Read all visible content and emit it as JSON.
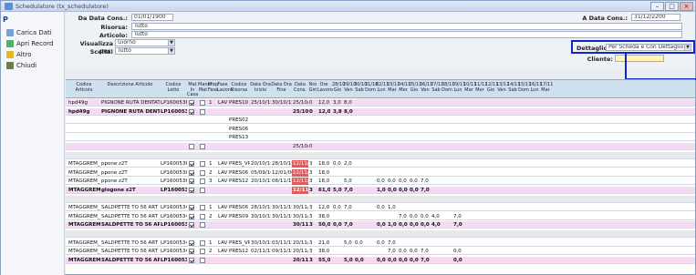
{
  "window": {
    "title": "Schedulatore (tx_schedulatore)",
    "controls": [
      "–",
      "□",
      "×"
    ]
  },
  "sidebar": {
    "items": [
      {
        "label": "Carica Dati",
        "icon": "refresh-icon"
      },
      {
        "label": "Apri Record",
        "icon": "open-record-icon"
      },
      {
        "label": "Altro",
        "icon": "more-icon"
      },
      {
        "label": "Chiudi",
        "icon": "close-icon"
      }
    ]
  },
  "filters": {
    "da_data_cons_label": "Da Data Cons.:",
    "da_data_cons_value": "01/01/1900",
    "a_data_cons_label": "A Data Cons.:",
    "a_data_cons_value": "31/12/2200",
    "risorsa_label": "Risorsa:",
    "risorsa_value": "Tutto",
    "articolo_label": "Articolo:",
    "articolo_value": "Tutto",
    "visualizza_label": "Visualizza per:",
    "visualizza_value": "Giorno",
    "scelta_label": "Scelta:",
    "scelta_value": "Tutto",
    "dettaglio_label": "Dettaglio:",
    "dettaglio_value": "Per Scheda e Con Dettaglio",
    "cliente_label": "Cliente:",
    "cliente_value": ""
  },
  "grid": {
    "columns": [
      "Codice Articolo",
      "Descrizione Articolo",
      "Codice Lotto",
      "Mat In Casa",
      "Manuf Mat",
      "Prep Fase",
      "Fase Lavoro",
      "Codice Risorsa",
      "Data Ora Inizio",
      "Data Ora Fine",
      "Data Cons.",
      "Nro Giri",
      "Ore Lavoro"
    ],
    "days": [
      "28/10 Gio",
      "29/10 Ven",
      "30/10 Sab",
      "31/10 Dom",
      "02/11 Lun",
      "03/11 Mar",
      "04/11 Mer",
      "05/11 Gio",
      "06/11 Ven",
      "07/11 Sab",
      "08/11 Dom",
      "09/11 Lun",
      "10/11 Mar",
      "11/11 Mer",
      "12/11 Gio",
      "13/11 Ven",
      "14/11 Sab",
      "15/11 Dom",
      "16/11 Lun",
      "17/11 Mar"
    ],
    "rows": [
      {
        "style": "pink",
        "art": "hpd49g",
        "desc": "PIGNONE RUTA DENTATA",
        "lotto": "LP1600536",
        "cb1": true,
        "cb2": false,
        "prep": "1",
        "fase": "LAV",
        "ris": "PRES10",
        "inizio": "25/10/15",
        "fine": "30/10/15",
        "cons": "25/10/15",
        "giri": "0",
        "ore": "12,0",
        "d1": "3,0",
        "d2": "8,0",
        "d3": "",
        "d4": "",
        "d5": "",
        "d6": "",
        "d7": "",
        "d8": "",
        "d9": "",
        "d10": "",
        "d11": "",
        "d12": ""
      },
      {
        "style": "pink",
        "art": "hpd49g",
        "desc": "PIGNONE RUTA DENTATA",
        "lotto": "LP1600536",
        "cb1": true,
        "cb2": false,
        "prep": "",
        "fase": "",
        "ris": "",
        "inizio": "",
        "fine": "",
        "cons": "25/10/15",
        "giri": "0",
        "ore": "12,0",
        "d1": "3,8",
        "d2": "8,0",
        "d3": "",
        "d4": "",
        "d5": "",
        "d6": "",
        "d7": "",
        "d8": "",
        "d9": "",
        "d10": "",
        "d11": "",
        "d12": "",
        "bold": true
      },
      {
        "style": "white",
        "art": "",
        "desc": "",
        "lotto": "",
        "cb1": null,
        "cb2": null,
        "prep": "",
        "fase": "",
        "ris": "PRES02",
        "inizio": "",
        "fine": "",
        "cons": "",
        "giri": "",
        "ore": "",
        "d1": "",
        "d2": "",
        "d3": "",
        "d4": "",
        "d5": "",
        "d6": "",
        "d7": "",
        "d8": "",
        "d9": "",
        "d10": "",
        "d11": "",
        "d12": ""
      },
      {
        "style": "white",
        "art": "",
        "desc": "",
        "lotto": "",
        "cb1": null,
        "cb2": null,
        "prep": "",
        "fase": "",
        "ris": "PRES06",
        "inizio": "",
        "fine": "",
        "cons": "",
        "giri": "",
        "ore": "",
        "d1": "",
        "d2": "",
        "d3": "",
        "d4": "",
        "d5": "",
        "d6": "",
        "d7": "",
        "d8": "",
        "d9": "",
        "d10": "",
        "d11": "",
        "d12": ""
      },
      {
        "style": "white",
        "art": "",
        "desc": "",
        "lotto": "",
        "cb1": null,
        "cb2": null,
        "prep": "",
        "fase": "",
        "ris": "PRES13",
        "inizio": "",
        "fine": "",
        "cons": "",
        "giri": "",
        "ore": "",
        "d1": "",
        "d2": "",
        "d3": "",
        "d4": "",
        "d5": "",
        "d6": "",
        "d7": "",
        "d8": "",
        "d9": "",
        "d10": "",
        "d11": "",
        "d12": ""
      },
      {
        "style": "pink",
        "art": "",
        "desc": "",
        "lotto": "",
        "cb1": false,
        "cb2": false,
        "prep": "",
        "fase": "",
        "ris": "",
        "inizio": "",
        "fine": "",
        "cons": "25/10/15",
        "giri": "0",
        "ore": "",
        "d1": "",
        "d2": "",
        "d3": "",
        "d4": "",
        "d5": "",
        "d6": "",
        "d7": "",
        "d8": "",
        "d9": "",
        "d10": "",
        "d11": "",
        "d12": ""
      },
      {
        "style": "sep",
        "art": "",
        "desc": "",
        "lotto": "",
        "cb1": null,
        "cb2": null,
        "prep": "",
        "fase": "",
        "ris": "",
        "inizio": "",
        "fine": "",
        "cons": "",
        "giri": "",
        "ore": "",
        "d1": "",
        "d2": "",
        "d3": "",
        "d4": "",
        "d5": "",
        "d6": "",
        "d7": "",
        "d8": "",
        "d9": "",
        "d10": "",
        "d11": "",
        "d12": ""
      },
      {
        "style": "white",
        "art": "MTAGGREM_SALD",
        "desc": "ppone z2T",
        "lotto": "LP1600536",
        "cb1": true,
        "cb2": false,
        "prep": "1",
        "fase": "LAV",
        "ris": "PRES_VP",
        "inizio": "20/10/15",
        "fine": "28/10/15",
        "cons": "12/11/15",
        "giri": "3",
        "ore": "18,0",
        "d1": "0,0",
        "d2": "2,0",
        "d3": "",
        "d4": "",
        "d5": "",
        "d6": "",
        "d7": "",
        "d8": "",
        "d9": "",
        "d10": "",
        "d11": "",
        "d12": "",
        "redcons": true
      },
      {
        "style": "white",
        "art": "MTAGGREM_SALD",
        "desc": "ppone z2T",
        "lotto": "LP1600536",
        "cb1": true,
        "cb2": false,
        "prep": "2",
        "fase": "LAV",
        "ris": "PRES06",
        "inizio": "05/09/16",
        "fine": "12/01/00",
        "cons": "12/11/15",
        "giri": "3",
        "ore": "18,0",
        "d1": "",
        "d2": "",
        "d3": "",
        "d4": "",
        "d5": "",
        "d6": "",
        "d7": "",
        "d8": "",
        "d9": "",
        "d10": "",
        "d11": "",
        "d12": "",
        "redcons": true
      },
      {
        "style": "white",
        "art": "MTAGGREM_SALD",
        "desc": "ppone z2T",
        "lotto": "LP1600536",
        "cb1": true,
        "cb2": false,
        "prep": "3",
        "fase": "LAV",
        "ris": "PRES12",
        "inizio": "20/10/15",
        "fine": "08/11/15",
        "cons": "12/11/15",
        "giri": "3",
        "ore": "18,0",
        "d1": "",
        "d2": "5,0",
        "d3": "",
        "d4": "",
        "d5": "0,0",
        "d6": "0,0",
        "d7": "0,0",
        "d8": "0,0",
        "d9": "7,0",
        "d10": "",
        "d11": "",
        "d12": "",
        "redcons": true
      },
      {
        "style": "pink",
        "art": "MTAGGREM_SALD",
        "desc": "glogone z2T",
        "lotto": "LP1600536",
        "cb1": true,
        "cb2": false,
        "prep": "",
        "fase": "",
        "ris": "",
        "inizio": "",
        "fine": "",
        "cons": "12/11/15",
        "giri": "3",
        "ore": "61,0",
        "d1": "5,0",
        "d2": "7,0",
        "d3": "",
        "d4": "",
        "d5": "1,0",
        "d6": "0,0",
        "d7": "0,0",
        "d8": "0,0",
        "d9": "7,0",
        "d10": "",
        "d11": "",
        "d12": "",
        "bold": true,
        "redcons": true
      },
      {
        "style": "sep",
        "art": "",
        "desc": "",
        "lotto": "",
        "cb1": null,
        "cb2": null,
        "prep": "",
        "fase": "",
        "ris": "",
        "inizio": "",
        "fine": "",
        "cons": "",
        "giri": "",
        "ore": "",
        "d1": "",
        "d2": "",
        "d3": "",
        "d4": "",
        "d5": "",
        "d6": "",
        "d7": "",
        "d8": "",
        "d9": "",
        "d10": "",
        "d11": "",
        "d12": ""
      },
      {
        "style": "white",
        "art": "MTAGGREM_SALD",
        "desc": "SALDPETTE TO 56 ART",
        "lotto": "LP1600534",
        "cb1": true,
        "cb2": false,
        "prep": "1",
        "fase": "LAV",
        "ris": "PRES06",
        "inizio": "28/10/15",
        "fine": "30/11/15",
        "cons": "30/11/15",
        "giri": "3",
        "ore": "12,0",
        "d1": "0,0",
        "d2": "7,0",
        "d3": "",
        "d4": "",
        "d5": "0,0",
        "d6": "1,0",
        "d7": "",
        "d8": "",
        "d9": "",
        "d10": "",
        "d11": "",
        "d12": ""
      },
      {
        "style": "white",
        "art": "MTAGGREM_SALD",
        "desc": "SALDPETTE TO 56 ART",
        "lotto": "LP1600534",
        "cb1": true,
        "cb2": false,
        "prep": "2",
        "fase": "LAV",
        "ris": "PRES09",
        "inizio": "30/10/15",
        "fine": "30/11/15",
        "cons": "30/11/15",
        "giri": "3",
        "ore": "38,0",
        "d1": "",
        "d2": "",
        "d3": "",
        "d4": "",
        "d5": "",
        "d6": "",
        "d7": "7,0",
        "d8": "0,0",
        "d9": "0,0",
        "d10": "4,0",
        "d11": "",
        "d12": "7,0"
      },
      {
        "style": "pink",
        "art": "MTAGGREM_SALD",
        "desc": "SALDPETTE TO 56 ART",
        "lotto": "LP1600534",
        "cb1": true,
        "cb2": false,
        "prep": "",
        "fase": "",
        "ris": "",
        "inizio": "",
        "fine": "",
        "cons": "30/11/15",
        "giri": "3",
        "ore": "50,0",
        "d1": "0,0",
        "d2": "7,0",
        "d3": "",
        "d4": "",
        "d5": "0,0",
        "d6": "1,0",
        "d7": "0,0",
        "d8": "0,0",
        "d9": "0,0",
        "d10": "4,0",
        "d11": "",
        "d12": "7,0",
        "bold": true
      },
      {
        "style": "sep",
        "art": "",
        "desc": "",
        "lotto": "",
        "cb1": null,
        "cb2": null,
        "prep": "",
        "fase": "",
        "ris": "",
        "inizio": "",
        "fine": "",
        "cons": "",
        "giri": "",
        "ore": "",
        "d1": "",
        "d2": "",
        "d3": "",
        "d4": "",
        "d5": "",
        "d6": "",
        "d7": "",
        "d8": "",
        "d9": "",
        "d10": "",
        "d11": "",
        "d12": ""
      },
      {
        "style": "white",
        "art": "MTAGGREM_SALD",
        "desc": "SALDPETTE TO 56 ART",
        "lotto": "LP1600534",
        "cb1": true,
        "cb2": false,
        "prep": "1",
        "fase": "LAV",
        "ris": "PRES_VP",
        "inizio": "30/10/15",
        "fine": "03/11/15",
        "cons": "20/11/15",
        "giri": "3",
        "ore": "21,0",
        "d1": "",
        "d2": "5,0",
        "d3": "0,0",
        "d4": "",
        "d5": "0,0",
        "d6": "7,0",
        "d7": "",
        "d8": "",
        "d9": "",
        "d10": "",
        "d11": "",
        "d12": ""
      },
      {
        "style": "white",
        "art": "MTAGGREM_SALD",
        "desc": "SALDPETTE TO 56 ART",
        "lotto": "LP1600534",
        "cb1": true,
        "cb2": false,
        "prep": "2",
        "fase": "LAV",
        "ris": "PRES12",
        "inizio": "02/11/15",
        "fine": "09/11/15",
        "cons": "20/11/15",
        "giri": "3",
        "ore": "38,0",
        "d1": "",
        "d2": "",
        "d3": "",
        "d4": "",
        "d5": "",
        "d6": "7,0",
        "d7": "0,0",
        "d8": "0,0",
        "d9": "7,0",
        "d10": "",
        "d11": "",
        "d12": "0,0"
      },
      {
        "style": "pink",
        "art": "MTAGGREM_SALD",
        "desc": "SALDPETTE TO 56 ART",
        "lotto": "LP1600534",
        "cb1": true,
        "cb2": false,
        "prep": "",
        "fase": "",
        "ris": "",
        "inizio": "",
        "fine": "",
        "cons": "20/11/15",
        "giri": "3",
        "ore": "55,0",
        "d1": "",
        "d2": "5,0",
        "d3": "0,0",
        "d4": "",
        "d5": "0,0",
        "d6": "0,0",
        "d7": "0,0",
        "d8": "0,0",
        "d9": "7,0",
        "d10": "",
        "d11": "",
        "d12": "0,0",
        "bold": true
      }
    ]
  }
}
